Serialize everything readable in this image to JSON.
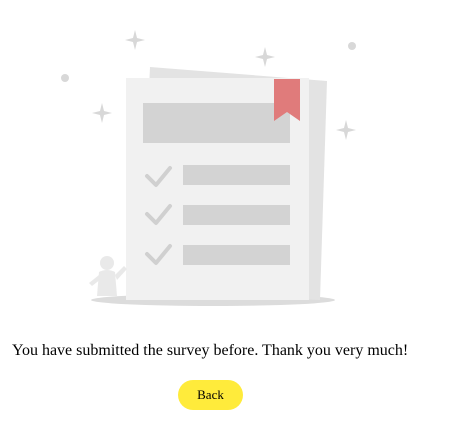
{
  "message": "You have submitted the survey before. Thank you very much!",
  "back_button": {
    "label": "Back"
  },
  "colors": {
    "button_bg": "#ffeb3b",
    "bookmark": "#e07b7b",
    "paper": "#f0f0f0",
    "placeholder": "#d3d3d3",
    "decor": "#d8d8d8"
  },
  "illustration": {
    "icon": "survey-checklist-illustration",
    "checklist_items": 3
  }
}
